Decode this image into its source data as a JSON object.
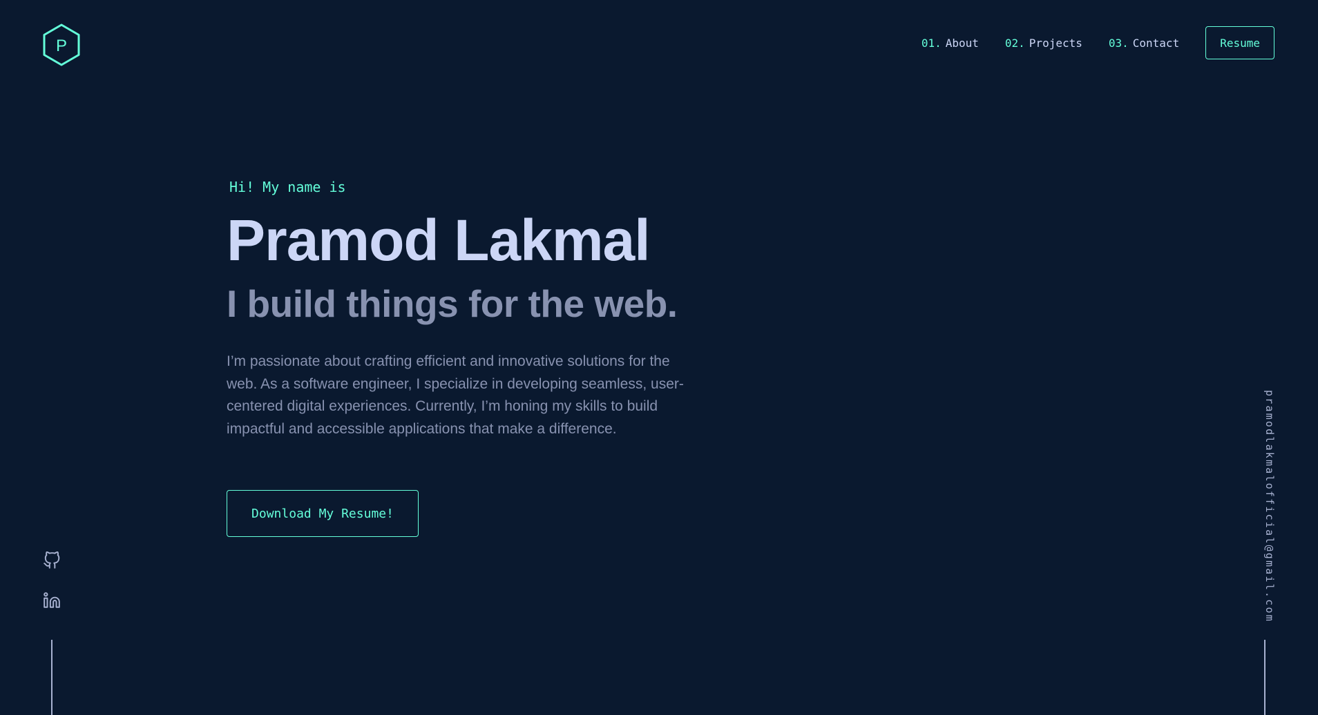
{
  "logo": {
    "letter": "P"
  },
  "nav": {
    "items": [
      {
        "num": "01.",
        "label": "About"
      },
      {
        "num": "02.",
        "label": "Projects"
      },
      {
        "num": "03.",
        "label": "Contact"
      }
    ],
    "resume_label": "Resume"
  },
  "hero": {
    "greeting": "Hi! My name is",
    "name": "Pramod Lakmal",
    "tagline": "I build things for the web.",
    "intro": "I’m passionate about crafting efficient and innovative solutions for the web. As a software engineer, I specialize in developing seamless, user-centered digital experiences. Currently, I’m honing my skills to build impactful and accessible applications that make a difference.",
    "cta_label": "Download My Resume!"
  },
  "social": {
    "icons": [
      "github-icon",
      "linkedin-icon"
    ]
  },
  "email": "pramodlakmalofficial@gmail.com",
  "colors": {
    "background": "#0a192f",
    "accent": "#64ffda",
    "heading": "#ccd6f6",
    "body": "#8892b0",
    "muted": "#a8b2d1"
  }
}
